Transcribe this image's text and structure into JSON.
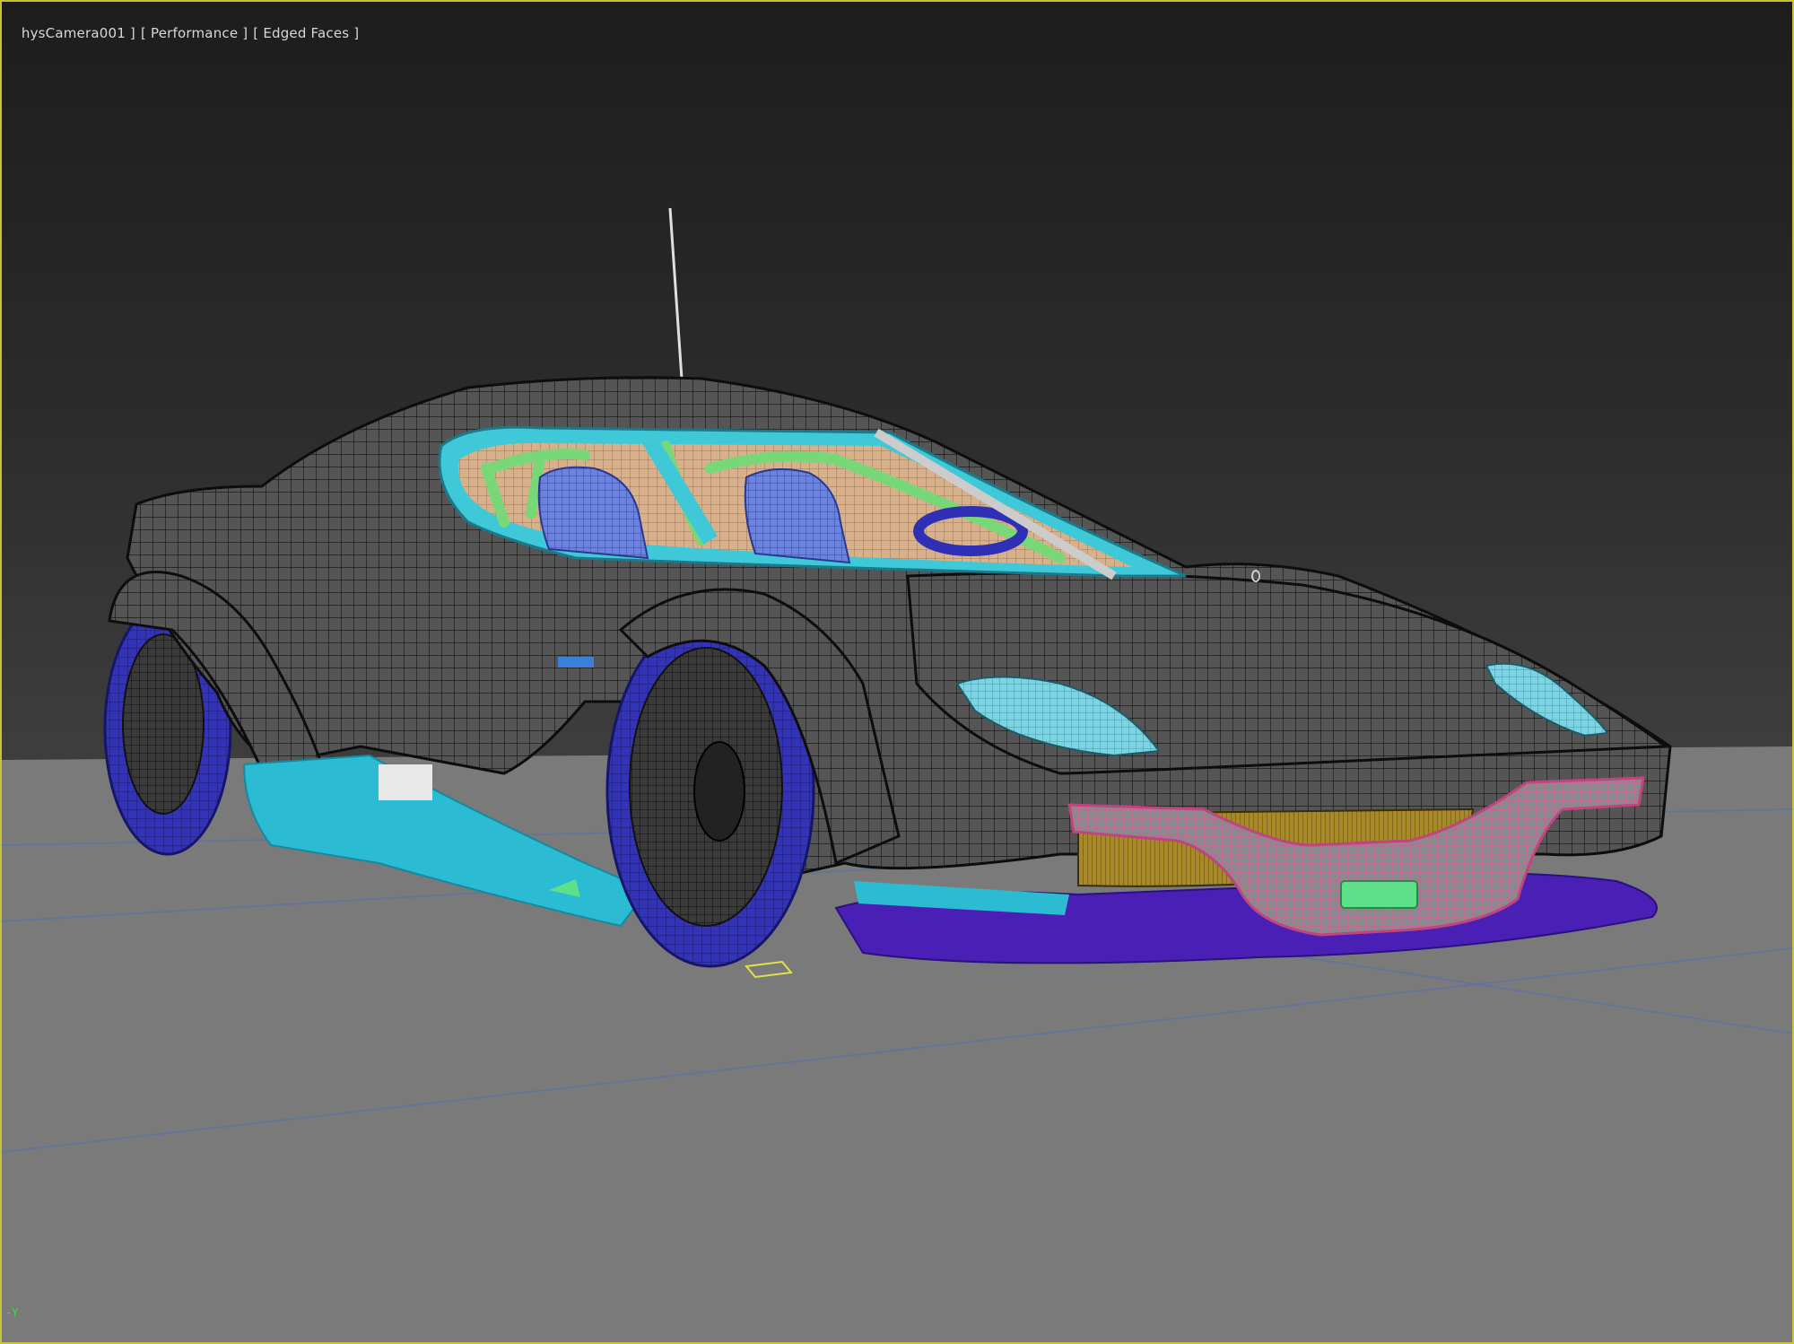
{
  "viewport": {
    "labels": [
      "hysCamera001 ]",
      "[ Performance ]",
      "[ Edged Faces ]"
    ],
    "axis_label": "-Y"
  },
  "colors": {
    "frame": "#c8c23a",
    "body": "#505050",
    "wire": "#111111",
    "tire": "#2f2fb5",
    "skirt": "#2bbbd3",
    "floor_pan": "#4a1fb5",
    "glass_trim": "#3ec8d8",
    "roll_cage": "#78d878",
    "interior": "#d9b18c",
    "bumper": "#d85b9d",
    "grille": "#a88a2a",
    "seat": "#5a73d6",
    "ground": "#7a7a7a"
  },
  "icons": {
    "viewport_gizmo": "axis-gizmo-icon"
  }
}
